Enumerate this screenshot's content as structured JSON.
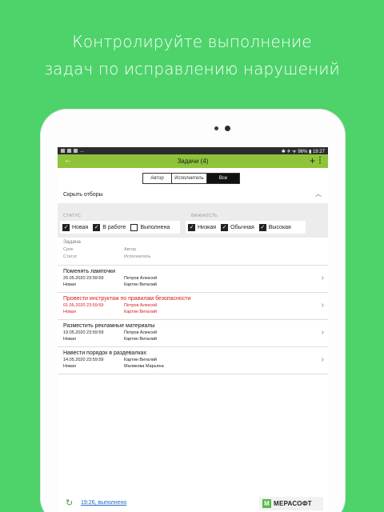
{
  "headline": {
    "line1": "Контролируйте выполнение",
    "line2": "задач по исправлению нарушений"
  },
  "statusbar": {
    "right": "✱ ✈ ᯤ 96% ▮ 19:27",
    "dots": "..."
  },
  "appbar": {
    "title": "Задачи (4)",
    "back_icon": "←",
    "plus_icon": "+",
    "more_icon": "⋮"
  },
  "segments": [
    "Автор",
    "Исполнитель",
    "Все"
  ],
  "segments_selected": "Все",
  "filters": {
    "toggle_label": "Скрыть отборы",
    "status_title": "СТАТУС",
    "status_options": [
      {
        "label": "Новая",
        "checked": true
      },
      {
        "label": "В работе",
        "checked": true
      },
      {
        "label": "Выполнена",
        "checked": false
      }
    ],
    "importance_title": "ВАЖНОСТЬ",
    "importance_options": [
      {
        "label": "Низкая",
        "checked": true
      },
      {
        "label": "Обычная",
        "checked": true
      },
      {
        "label": "Высокая",
        "checked": true
      }
    ]
  },
  "columns": {
    "task": "Задача",
    "due": "Срок",
    "author": "Автор",
    "status": "Статус",
    "executor": "Исполнитель"
  },
  "tasks": [
    {
      "name": "Поменять лампочки",
      "due": "20.05.2020 23:59:59",
      "author": "Петров Алексей",
      "status": "Новая",
      "executor": "Картин Виталий",
      "overdue": false
    },
    {
      "name": "Провести инструктаж по правилам безопасности",
      "due": "01.05.2020 23:59:59",
      "author": "Петров Алексей",
      "status": "Новая",
      "executor": "Картин Виталий",
      "overdue": true
    },
    {
      "name": "Разместить рекламные материалы",
      "due": "19.05.2020 23:59:59",
      "author": "Петров Алексей",
      "status": "Новая",
      "executor": "Картин Виталий",
      "overdue": false
    },
    {
      "name": "Навести порядок в раздевалках",
      "due": "14.05.2020 23:59:59",
      "author": "Картин Виталий",
      "status": "Новая",
      "executor": "Маликова Марьяна",
      "overdue": false
    }
  ],
  "footer": {
    "sync_text": "19:26, выполнено",
    "logo_text": "МЕРАСОФТ",
    "logo_mark": "М"
  },
  "colors": {
    "background": "#4dd36a",
    "appbar": "#8fc43a",
    "overdue": "#d61a1a",
    "link": "#1a6cc9"
  }
}
